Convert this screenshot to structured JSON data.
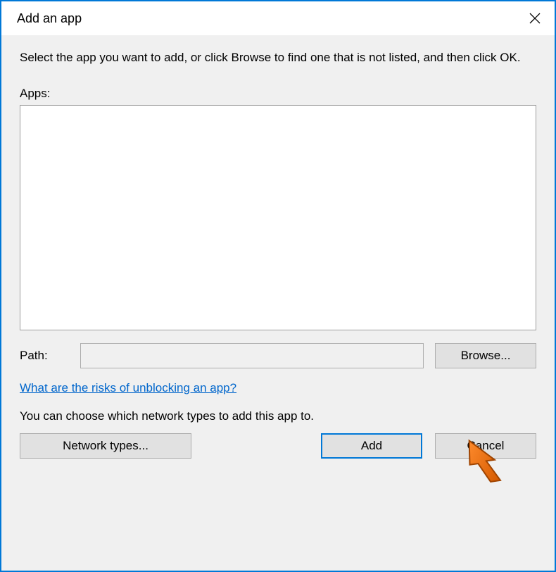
{
  "titlebar": {
    "title": "Add an app"
  },
  "content": {
    "description": "Select the app you want to add, or click Browse to find one that is not listed, and then click OK.",
    "apps_label": "Apps:",
    "path_label": "Path:",
    "path_value": "",
    "browse_label": "Browse...",
    "risks_link": "What are the risks of unblocking an app?",
    "network_text": "You can choose which network types to add this app to.",
    "network_types_label": "Network types...",
    "add_label": "Add",
    "cancel_label": "Cancel"
  }
}
